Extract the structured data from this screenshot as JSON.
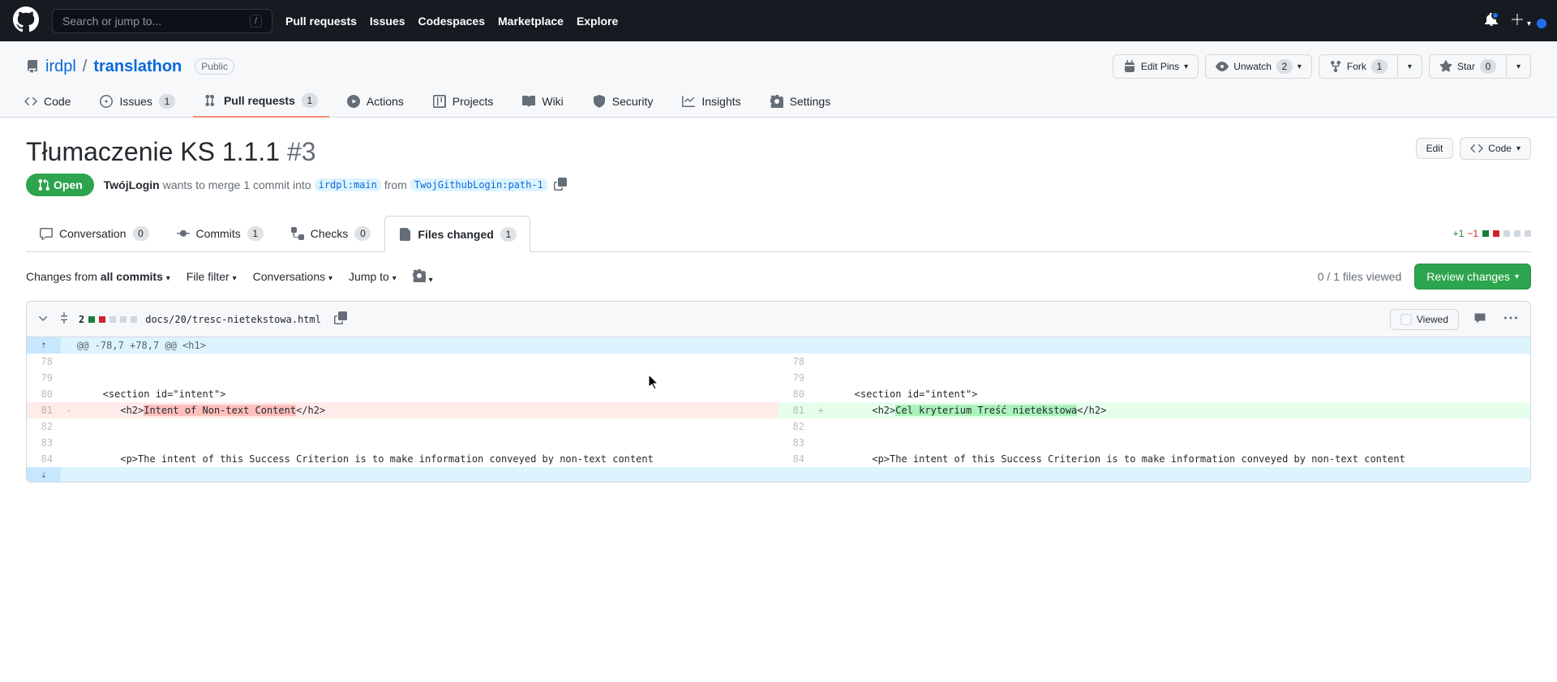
{
  "header": {
    "search_placeholder": "Search or jump to...",
    "slash": "/",
    "nav": [
      "Pull requests",
      "Issues",
      "Codespaces",
      "Marketplace",
      "Explore"
    ]
  },
  "repo": {
    "owner": "irdpl",
    "name": "translathon",
    "visibility": "Public",
    "actions": {
      "edit_pins": "Edit Pins",
      "unwatch": "Unwatch",
      "unwatch_count": "2",
      "fork": "Fork",
      "fork_count": "1",
      "star": "Star",
      "star_count": "0"
    },
    "nav": {
      "code": "Code",
      "issues": "Issues",
      "issues_count": "1",
      "pulls": "Pull requests",
      "pulls_count": "1",
      "actions": "Actions",
      "projects": "Projects",
      "wiki": "Wiki",
      "security": "Security",
      "insights": "Insights",
      "settings": "Settings"
    }
  },
  "pr": {
    "title": "Tłumaczenie KS 1.1.1",
    "number": "#3",
    "state": "Open",
    "author": "TwójLogin",
    "wants": "wants to merge 1 commit into",
    "base": "irdpl:main",
    "from": "from",
    "head": "TwojGithubLogin:path-1",
    "edit": "Edit",
    "code_btn": "Code"
  },
  "tabs": {
    "conversation": "Conversation",
    "conversation_count": "0",
    "commits": "Commits",
    "commits_count": "1",
    "checks": "Checks",
    "checks_count": "0",
    "files": "Files changed",
    "files_count": "1",
    "stat_add": "+1",
    "stat_del": "−1"
  },
  "toolbar": {
    "changes_from": "Changes from ",
    "all_commits": "all commits",
    "file_filter": "File filter",
    "conversations": "Conversations",
    "jump_to": "Jump to",
    "files_viewed": "0 / 1 files viewed",
    "review": "Review changes"
  },
  "file": {
    "changes": "2",
    "path": "docs/20/tresc-nietekstowa.html",
    "viewed": "Viewed",
    "hunk": "@@ -78,7 +78,7 @@ <h1>",
    "rows": [
      {
        "ln_l": "78",
        "ln_r": "78",
        "text": ""
      },
      {
        "ln_l": "79",
        "ln_r": "79",
        "text": ""
      },
      {
        "ln_l": "80",
        "ln_r": "80",
        "text": "   <section id=\"intent\">"
      },
      {
        "ln_l": "81",
        "del": true,
        "text": "      <h2>Intent of Non-text Content</h2>",
        "hl_l": "Intent of Non-text Content"
      },
      {
        "ln_r": "81",
        "add": true,
        "text": "      <h2>Cel kryterium Treść nietekstowa</h2>",
        "hl_r": "Cel kryterium Treść nietekstowa"
      },
      {
        "ln_l": "82",
        "ln_r": "82",
        "text": ""
      },
      {
        "ln_l": "83",
        "ln_r": "83",
        "text": ""
      },
      {
        "ln_l": "84",
        "ln_r": "84",
        "text": "      <p>The intent of this Success Criterion is to make information conveyed by non-text content"
      }
    ]
  }
}
